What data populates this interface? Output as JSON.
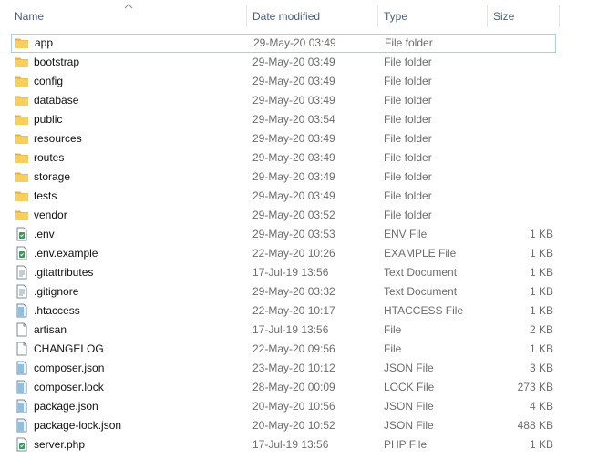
{
  "columns": {
    "name": "Name",
    "date": "Date modified",
    "type": "Type",
    "size": "Size"
  },
  "sort": {
    "column": "name",
    "direction": "ascending"
  },
  "colors": {
    "folder": "#f5c24c",
    "header_text": "#4c607a",
    "selection_border": "#99d1ff"
  },
  "files": [
    {
      "name": "app",
      "date": "29-May-20 03:49",
      "type": "File folder",
      "size": "",
      "icon": "folder-icon",
      "selected": true
    },
    {
      "name": "bootstrap",
      "date": "29-May-20 03:49",
      "type": "File folder",
      "size": "",
      "icon": "folder-icon"
    },
    {
      "name": "config",
      "date": "29-May-20 03:49",
      "type": "File folder",
      "size": "",
      "icon": "folder-icon"
    },
    {
      "name": "database",
      "date": "29-May-20 03:49",
      "type": "File folder",
      "size": "",
      "icon": "folder-icon"
    },
    {
      "name": "public",
      "date": "29-May-20 03:54",
      "type": "File folder",
      "size": "",
      "icon": "folder-icon"
    },
    {
      "name": "resources",
      "date": "29-May-20 03:49",
      "type": "File folder",
      "size": "",
      "icon": "folder-icon"
    },
    {
      "name": "routes",
      "date": "29-May-20 03:49",
      "type": "File folder",
      "size": "",
      "icon": "folder-icon"
    },
    {
      "name": "storage",
      "date": "29-May-20 03:49",
      "type": "File folder",
      "size": "",
      "icon": "folder-icon"
    },
    {
      "name": "tests",
      "date": "29-May-20 03:49",
      "type": "File folder",
      "size": "",
      "icon": "folder-icon"
    },
    {
      "name": "vendor",
      "date": "29-May-20 03:52",
      "type": "File folder",
      "size": "",
      "icon": "folder-icon"
    },
    {
      "name": ".env",
      "date": "29-May-20 03:53",
      "type": "ENV File",
      "size": "1 KB",
      "icon": "code-file-icon"
    },
    {
      "name": ".env.example",
      "date": "22-May-20 10:26",
      "type": "EXAMPLE File",
      "size": "1 KB",
      "icon": "code-file-icon"
    },
    {
      "name": ".gitattributes",
      "date": "17-Jul-19 13:56",
      "type": "Text Document",
      "size": "1 KB",
      "icon": "text-file-icon"
    },
    {
      "name": ".gitignore",
      "date": "29-May-20 03:32",
      "type": "Text Document",
      "size": "1 KB",
      "icon": "text-file-icon"
    },
    {
      "name": ".htaccess",
      "date": "22-May-20 10:17",
      "type": "HTACCESS File",
      "size": "1 KB",
      "icon": "generic-file-icon"
    },
    {
      "name": "artisan",
      "date": "17-Jul-19 13:56",
      "type": "File",
      "size": "2 KB",
      "icon": "blank-file-icon"
    },
    {
      "name": "CHANGELOG",
      "date": "22-May-20 09:56",
      "type": "File",
      "size": "1 KB",
      "icon": "blank-file-icon"
    },
    {
      "name": "composer.json",
      "date": "23-May-20 10:12",
      "type": "JSON File",
      "size": "3 KB",
      "icon": "generic-file-icon"
    },
    {
      "name": "composer.lock",
      "date": "28-May-20 00:09",
      "type": "LOCK File",
      "size": "273 KB",
      "icon": "generic-file-icon"
    },
    {
      "name": "package.json",
      "date": "20-May-20 10:56",
      "type": "JSON File",
      "size": "4 KB",
      "icon": "generic-file-icon"
    },
    {
      "name": "package-lock.json",
      "date": "20-May-20 10:52",
      "type": "JSON File",
      "size": "488 KB",
      "icon": "generic-file-icon"
    },
    {
      "name": "server.php",
      "date": "17-Jul-19 13:56",
      "type": "PHP File",
      "size": "1 KB",
      "icon": "code-file-icon"
    }
  ]
}
